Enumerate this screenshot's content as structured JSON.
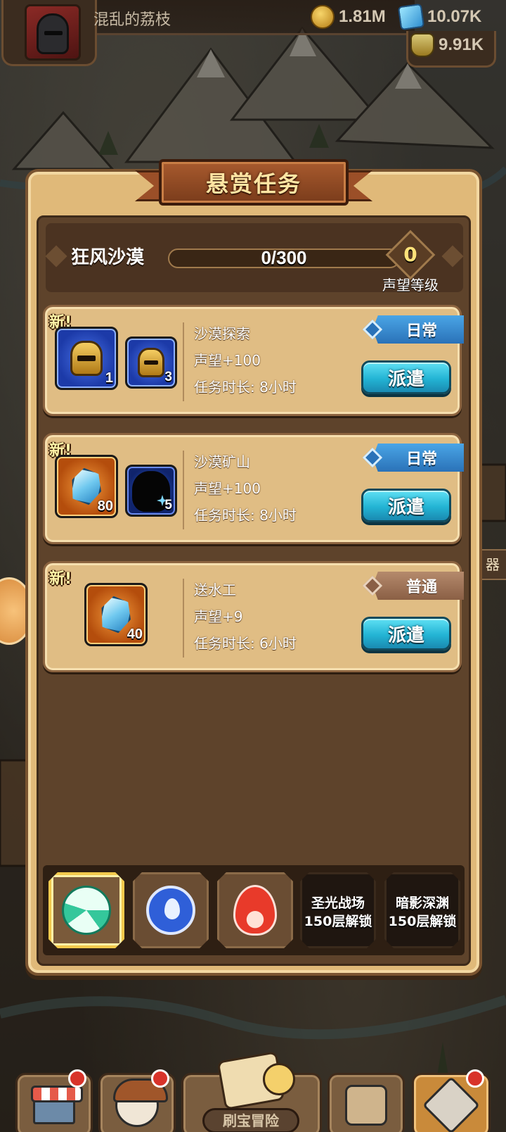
{
  "player": {
    "name": "混乱的荔枝"
  },
  "resources": {
    "gold": "1.81M",
    "gems": "10.07K",
    "potion": "9.91K"
  },
  "panel": {
    "title": "悬赏任务",
    "region": {
      "name": "狂风沙漠",
      "progress_text": "0/300",
      "progress_fraction": 0,
      "level": "0",
      "level_label": "声望等级"
    },
    "tasks": [
      {
        "new_label": "新!",
        "name": "沙漠探索",
        "reputation": "声望+100",
        "duration": "任务时长: 8小时",
        "type": "日常",
        "dispatch": "派遣",
        "rewards": [
          {
            "icon": "golden-helmet-icon",
            "count": "1"
          },
          {
            "icon": "golden-helmet-icon",
            "count": "3"
          }
        ]
      },
      {
        "new_label": "新!",
        "name": "沙漠矿山",
        "reputation": "声望+100",
        "duration": "任务时长: 8小时",
        "type": "日常",
        "dispatch": "派遣",
        "rewards": [
          {
            "icon": "blue-crystal-icon",
            "count": "80"
          },
          {
            "icon": "hero-silhouette-icon",
            "count": "5"
          }
        ]
      },
      {
        "new_label": "新!",
        "name": "送水工",
        "reputation": "声望+9",
        "duration": "任务时长: 6小时",
        "type": "普通",
        "dispatch": "派遣",
        "rewards": [
          {
            "icon": "blue-crystal-icon",
            "count": "40"
          }
        ]
      }
    ],
    "element_tabs": [
      {
        "icon": "wind-icon",
        "active": true
      },
      {
        "icon": "water-icon",
        "active": false
      },
      {
        "icon": "fire-icon",
        "active": false
      },
      {
        "label_line1": "圣光战场",
        "label_line2": "150层解锁",
        "locked": true
      },
      {
        "label_line1": "暗影深渊",
        "label_line2": "150层解锁",
        "locked": true
      }
    ]
  },
  "side_tab": {
    "label": "器"
  },
  "bottom_nav": {
    "adventure_label": "刷宝冒险",
    "items": [
      "shop-icon",
      "hero-icon",
      "adventure-icon",
      "bag-icon",
      "forge-icon"
    ]
  },
  "colors": {
    "panel_bg": "#e0b979",
    "dispatch_button": "#23b4d4",
    "daily_banner": "#2a72b8",
    "normal_banner": "#8a5f45",
    "active_tab_border": "#f2c94c"
  }
}
